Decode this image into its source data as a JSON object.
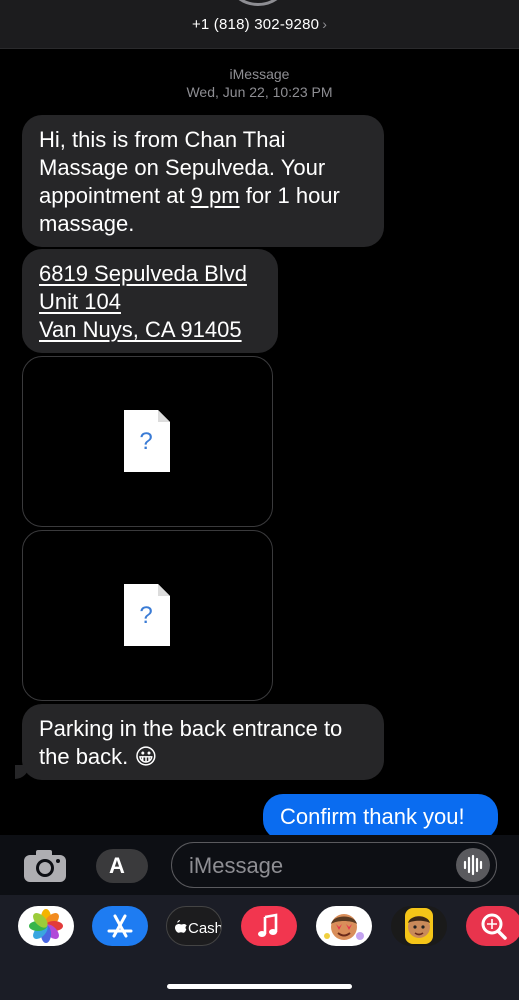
{
  "header": {
    "contact_number": "+1 (818) 302-9280",
    "chevron": "›"
  },
  "timestamp": {
    "service": "iMessage",
    "datetime": "Wed, Jun 22, 10:23 PM"
  },
  "messages": {
    "m1": {
      "pre": "Hi, this is from Chan Thai Massage on Sepulveda. Your appointment at ",
      "link": "9 pm",
      "post": " for 1 hour massage."
    },
    "m2": {
      "line1": "6819 Sepulveda Blvd",
      "line2": "Unit 104",
      "line3": "Van Nuys, CA 91405"
    },
    "missing_image_glyph": "?",
    "m5": {
      "text": "Parking in the back entrance to the back.",
      "emoji": "😀"
    },
    "sent1": {
      "text": "Confirm thank you!"
    }
  },
  "input": {
    "placeholder": "iMessage",
    "apps_glyph": "A"
  },
  "app_drawer": {
    "items": [
      "photos-app",
      "app-store-app",
      "apple-cash-app",
      "music-app",
      "memoji-stickers",
      "animoji",
      "search-images-app"
    ],
    "cash_label": "Cash",
    "colors": {
      "app_store": "#1e7cf2",
      "music": "#f2364f",
      "search": "#e8344d",
      "cash": "#1c1c1e"
    }
  },
  "colors": {
    "received": "#262628",
    "sent": "#0a6cf0",
    "background": "#000000"
  }
}
